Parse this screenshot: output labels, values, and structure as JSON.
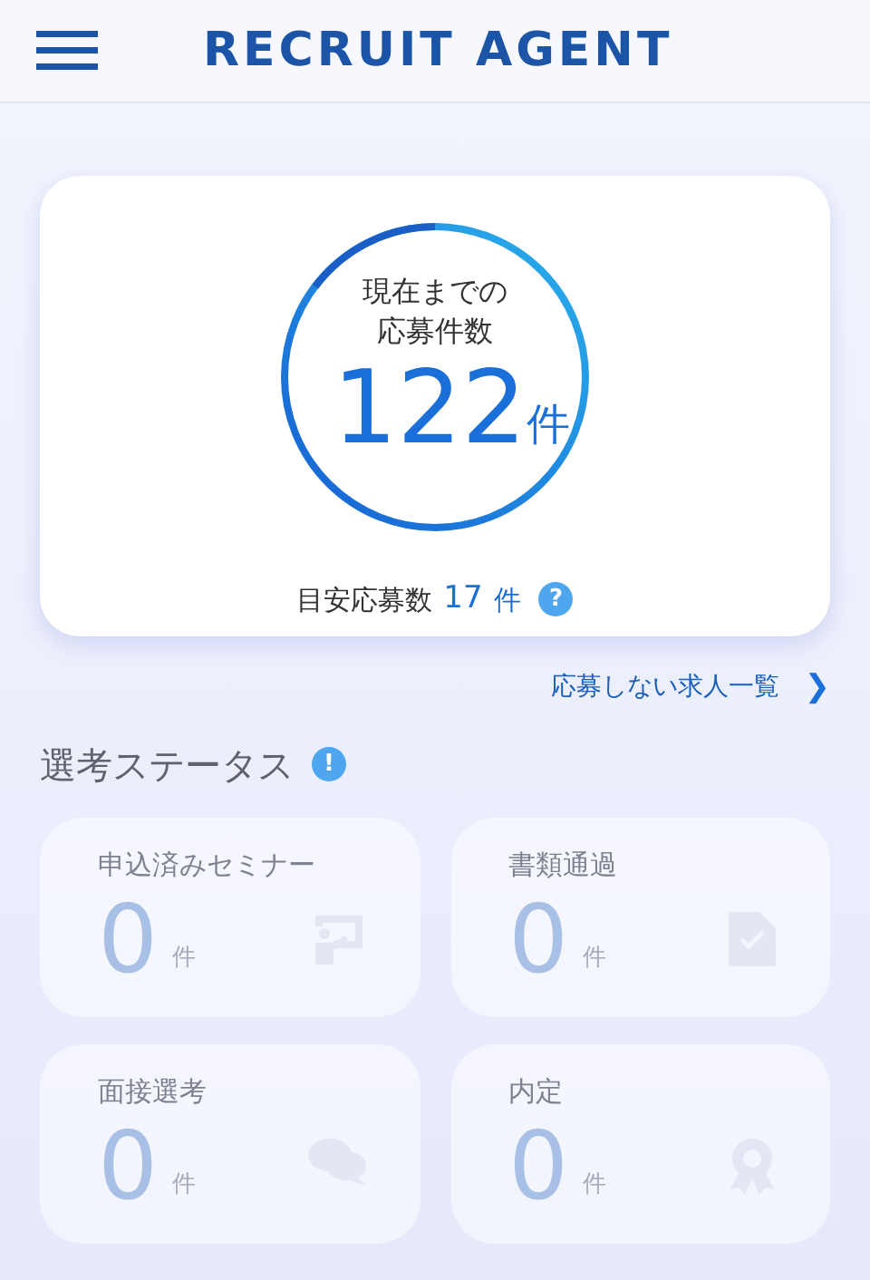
{
  "header": {
    "title": "RECRUIT AGENT"
  },
  "summary": {
    "caption_line1": "現在までの",
    "caption_line2": "応募件数",
    "count": "122",
    "unit": "件",
    "target_label": "目安応募数",
    "target_count": "17",
    "target_unit": "件",
    "help": "?"
  },
  "link": {
    "label": "応募しない求人一覧",
    "arrow": "❯"
  },
  "section": {
    "title": "選考ステータス",
    "alert": "!"
  },
  "statuses": [
    {
      "label": "申込済みセミナー",
      "count": "0",
      "unit": "件",
      "kind": "seminar"
    },
    {
      "label": "書類通過",
      "count": "0",
      "unit": "件",
      "kind": "document"
    },
    {
      "label": "面接選考",
      "count": "0",
      "unit": "件",
      "kind": "chat"
    },
    {
      "label": "内定",
      "count": "0",
      "unit": "件",
      "kind": "award"
    }
  ]
}
